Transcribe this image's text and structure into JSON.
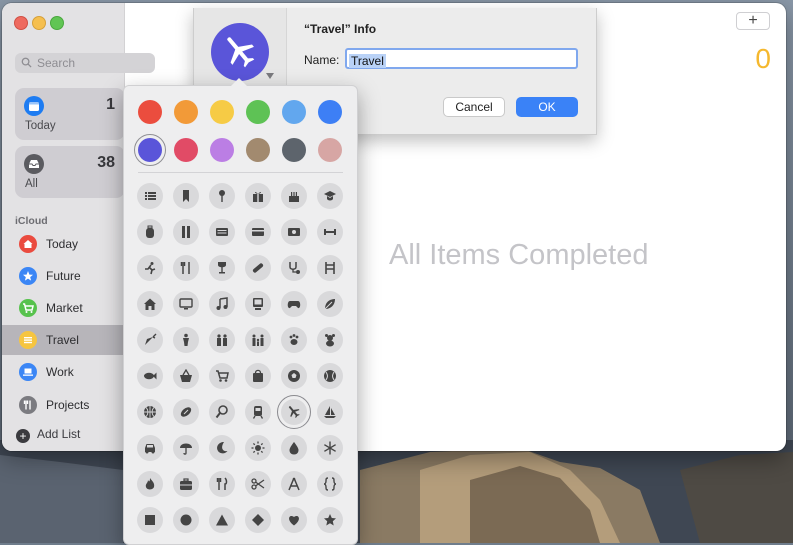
{
  "sidebar": {
    "search_placeholder": "Search",
    "smart_lists": [
      {
        "label": "Today",
        "count": "1",
        "icon": "calendar-icon",
        "color": "#1e7cf2"
      },
      {
        "label": "All",
        "count": "38",
        "icon": "tray-icon",
        "color": "#5b5b60"
      }
    ],
    "section_title": "iCloud",
    "lists": [
      {
        "label": "Today",
        "icon": "house-icon",
        "color": "#ea4b3f"
      },
      {
        "label": "Future",
        "icon": "star-icon",
        "color": "#3b86f5"
      },
      {
        "label": "Market",
        "icon": "cart-icon",
        "color": "#57c24d"
      },
      {
        "label": "Travel",
        "icon": "list-icon",
        "color": "#f6c540",
        "selected": true
      },
      {
        "label": "Work",
        "icon": "laptop-icon",
        "color": "#3b86f5"
      },
      {
        "label": "Projects",
        "icon": "fork-knife-icon",
        "color": "#7b7b80"
      }
    ],
    "add_list_label": "Add List"
  },
  "content": {
    "add_button_label": "+",
    "item_count": "0",
    "empty_message": "All Items Completed",
    "accent_color": "#f5b82e"
  },
  "info_sheet": {
    "title": "“Travel” Info",
    "name_label": "Name:",
    "name_value": "Travel",
    "cancel_label": "Cancel",
    "ok_label": "OK",
    "badge_icon": "airplane-icon",
    "badge_color": "#5a55d9"
  },
  "picker": {
    "colors": [
      "#eb4d3e",
      "#f29a38",
      "#f6cb45",
      "#5ec255",
      "#62a7ee",
      "#3d7ff5",
      "#5a55d9",
      "#e14b66",
      "#bb7ee4",
      "#a28a6f",
      "#5d646c",
      "#d7a6a4"
    ],
    "selected_color_index": 6,
    "icons": [
      "list-icon",
      "bookmark-icon",
      "pin-icon",
      "gift-icon",
      "cake-icon",
      "graduation-cap-icon",
      "backpack-icon",
      "pencil-ruler-icon",
      "document-icon",
      "credit-card-icon",
      "money-icon",
      "dumbbell-icon",
      "running-icon",
      "fork-knife-icon",
      "wine-glass-icon",
      "pills-icon",
      "stethoscope-icon",
      "chair-icon",
      "house-icon",
      "monitor-icon",
      "music-note-icon",
      "desktop-icon",
      "gamepad-icon",
      "leaf-icon",
      "carrot-icon",
      "person-icon",
      "people-icon",
      "family-icon",
      "paw-icon",
      "teddy-bear-icon",
      "fish-icon",
      "basket-icon",
      "cart-icon",
      "shopping-bag-icon",
      "soccer-ball-icon",
      "baseball-icon",
      "basketball-icon",
      "football-icon",
      "tennis-icon",
      "train-icon",
      "airplane-icon",
      "sailboat-icon",
      "car-icon",
      "umbrella-icon",
      "moon-icon",
      "sun-icon",
      "drop-icon",
      "snowflake-icon",
      "flame-icon",
      "briefcase-icon",
      "utensils-icon",
      "scissors-icon",
      "compass-icon",
      "braces-icon",
      "square-icon",
      "circle-icon",
      "triangle-icon",
      "diamond-icon",
      "heart-icon",
      "star-icon"
    ],
    "selected_icon_index": 40
  }
}
